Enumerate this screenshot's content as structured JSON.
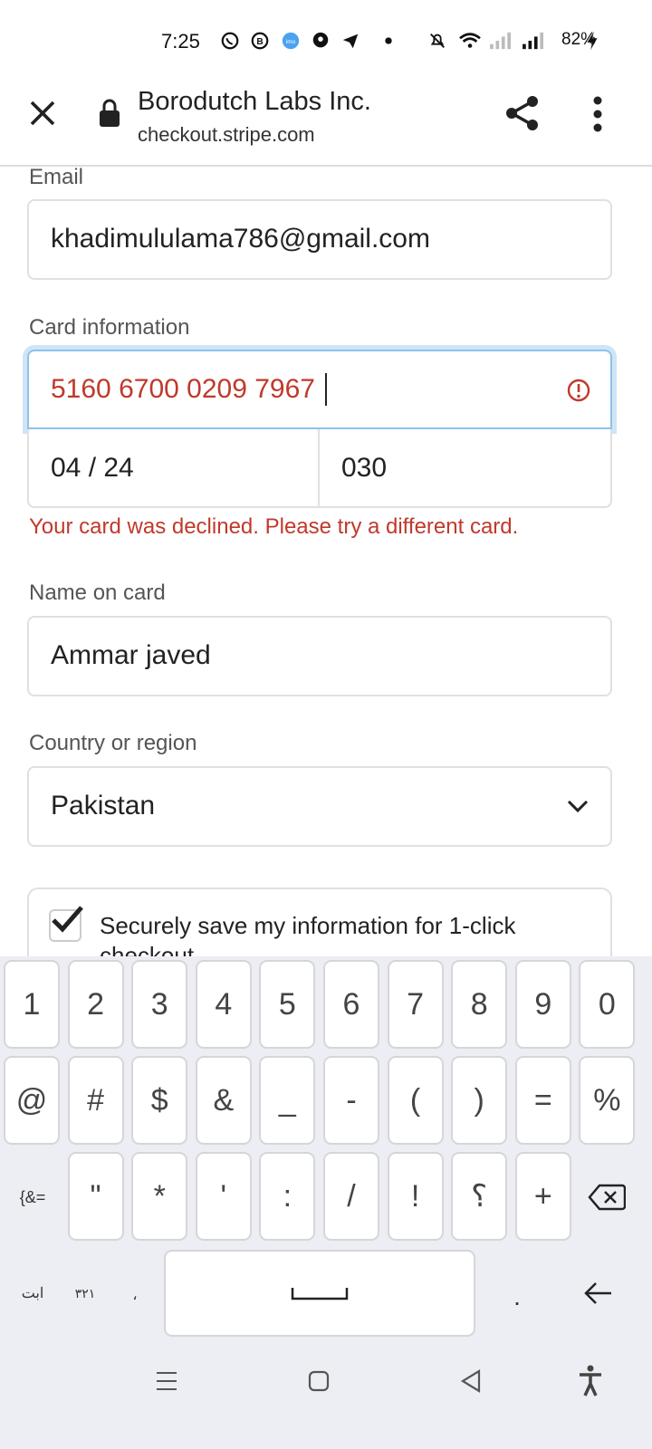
{
  "status_bar": {
    "time": "7:25",
    "battery": "82%"
  },
  "header": {
    "title": "Borodutch Labs Inc.",
    "url": "checkout.stripe.com"
  },
  "form": {
    "email": {
      "label": "Email",
      "value": "khadimululama786@gmail.com"
    },
    "card": {
      "label": "Card information",
      "number": "5160 6700 0209 7967",
      "expiry": "04 / 24",
      "cvc": "030",
      "error": "Your card was declined. Please try a different card."
    },
    "name": {
      "label": "Name on card",
      "value": "Ammar javed"
    },
    "country": {
      "label": "Country or region",
      "value": "Pakistan"
    },
    "save": {
      "label_line1": "Securely save my information for 1-click",
      "label_line2": "checkout",
      "checked": true
    }
  },
  "keyboard": {
    "row1": [
      "1",
      "2",
      "3",
      "4",
      "5",
      "6",
      "7",
      "8",
      "9",
      "0"
    ],
    "row2": [
      "@",
      "#",
      "$",
      "&",
      "_",
      "-",
      "(",
      ")",
      "=",
      "%"
    ],
    "row3_left": "{&=",
    "row3": [
      "\"",
      "*",
      "'",
      ":",
      "/",
      "!",
      "؟",
      "+"
    ],
    "row4": {
      "left_lang": "ابت",
      "digits": "۳۲۱",
      "comma": "،",
      "period": "."
    }
  },
  "colors": {
    "error": "#c0392b",
    "focus": "#8ec2ea",
    "keyboard_bg": "#eceef3"
  }
}
